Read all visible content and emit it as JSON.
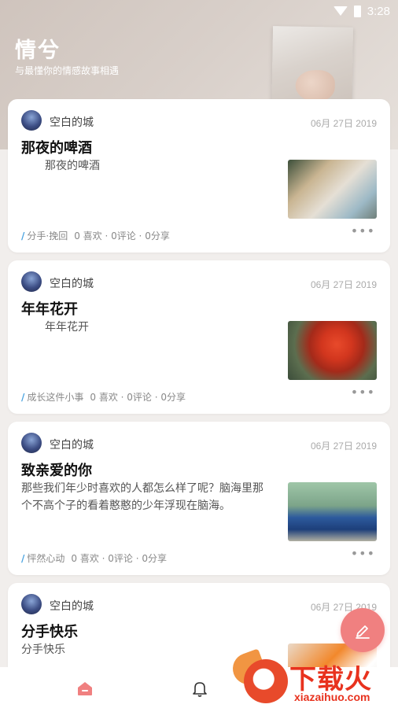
{
  "status_bar": {
    "time": "3:28"
  },
  "header": {
    "title": "情兮",
    "subtitle": "与最懂你的情感故事相遇"
  },
  "posts": [
    {
      "author": "空白的城",
      "date": "06月 27日 2019",
      "title": "那夜的啤酒",
      "excerpt": "那夜的啤酒",
      "tag": "分手·挽回",
      "stats": "0 喜欢 · 0评论 · 0分享"
    },
    {
      "author": "空白的城",
      "date": "06月 27日 2019",
      "title": "年年花开",
      "excerpt": "年年花开",
      "tag": "成长这件小事",
      "stats": "0 喜欢 · 0评论 · 0分享"
    },
    {
      "author": "空白的城",
      "date": "06月 27日 2019",
      "title": "致亲爱的你",
      "excerpt": "那些我们年少时喜欢的人都怎么样了呢？脑海里那个不高个子的看着憨憨的少年浮现在脑海。",
      "tag": "怦然心动",
      "stats": "0 喜欢 · 0评论 · 0分享"
    },
    {
      "author": "空白的城",
      "date": "06月 27日 2019",
      "title": "分手快乐",
      "excerpt": "分手快乐"
    }
  ],
  "more_label": "•••",
  "watermark": {
    "text": "下载火",
    "url": "xiazaihuo.com"
  },
  "icons": {
    "fab": "edit-pen-icon",
    "nav_home": "home-icon",
    "nav_notifications": "bell-icon"
  },
  "colors": {
    "accent": "#f08080",
    "tag_slash": "#4aa3e0",
    "home_active": "#f08080"
  }
}
